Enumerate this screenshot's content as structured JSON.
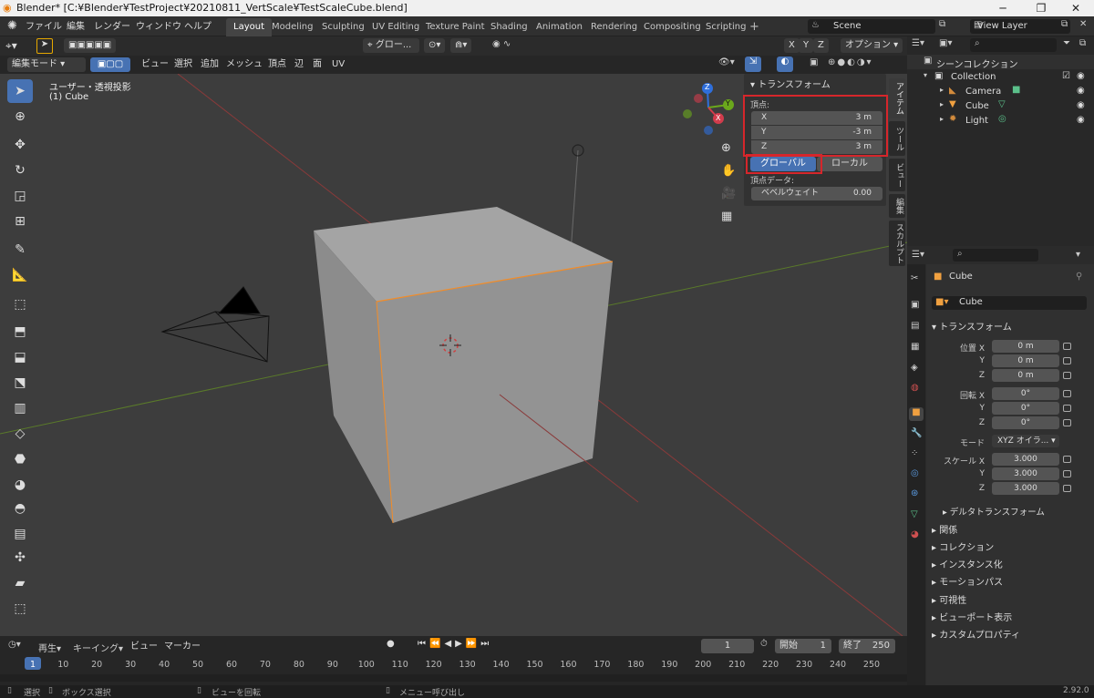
{
  "window": {
    "title": "Blender* [C:¥Blender¥TestProject¥20210811_VertScale¥TestScaleCube.blend]"
  },
  "menu": [
    "ファイル",
    "編集",
    "レンダー",
    "ウィンドウ",
    "ヘルプ"
  ],
  "workspaces": [
    "Layout",
    "Modeling",
    "Sculpting",
    "UV Editing",
    "Texture Paint",
    "Shading",
    "Animation",
    "Rendering",
    "Compositing",
    "Scripting"
  ],
  "active_workspace": "Layout",
  "scene": "Scene",
  "view_layer": "View Layer",
  "header": {
    "transform_orientation": "グロー...",
    "axes": [
      "X",
      "Y",
      "Z"
    ],
    "options": "オプション"
  },
  "header2": {
    "mode": "編集モード",
    "items": [
      "ビュー",
      "選択",
      "追加",
      "メッシュ",
      "頂点",
      "辺",
      "面",
      "UV"
    ]
  },
  "viewport": {
    "view_name": "ユーザー・透視投影",
    "object_name": "(1) Cube",
    "gizmo": {
      "x": "X",
      "y": "Y",
      "z": "Z"
    }
  },
  "npanel": {
    "header": "トランスフォーム",
    "vertex_label": "頂点:",
    "fields": [
      {
        "axis": "X",
        "value": "3 m"
      },
      {
        "axis": "Y",
        "value": "-3 m"
      },
      {
        "axis": "Z",
        "value": "3 m"
      }
    ],
    "global_label": "グローバル",
    "local_label": "ローカル",
    "vertex_data_label": "頂点データ:",
    "bevel_label": "ベベルウェイト",
    "bevel_value": "0.00",
    "tabs": [
      "アイテム",
      "ツール",
      "ビュー",
      "編集",
      "スカルプト"
    ]
  },
  "outliner": {
    "title": "シーンコレクション",
    "items": [
      {
        "name": "Collection"
      },
      {
        "name": "Camera"
      },
      {
        "name": "Cube"
      },
      {
        "name": "Light"
      }
    ]
  },
  "properties": {
    "object_name": "Cube",
    "data_name": "Cube",
    "section": "トランスフォーム",
    "location_label": "位置 X",
    "location": [
      "0 m",
      "0 m",
      "0 m"
    ],
    "rotation_label": "回転 X",
    "rotation": [
      "0°",
      "0°",
      "0°"
    ],
    "mode_label": "モード",
    "mode_value": "XYZ オイラ...",
    "scale_label": "スケール X",
    "scale": [
      "3.000",
      "3.000",
      "3.000"
    ],
    "axis_y": "Y",
    "axis_z": "Z",
    "delta": "デルタトランスフォーム",
    "sections": [
      "関係",
      "コレクション",
      "インスタンス化",
      "モーションパス",
      "可視性",
      "ビューポート表示",
      "カスタムプロパティ"
    ]
  },
  "timeline": {
    "menus": [
      "再生",
      "キーイング",
      "ビュー",
      "マーカー"
    ],
    "current_frame": "1",
    "start_label": "開始",
    "start": "1",
    "end_label": "終了",
    "end": "250",
    "ticks": [
      "1",
      "10",
      "20",
      "30",
      "40",
      "50",
      "60",
      "70",
      "80",
      "90",
      "100",
      "110",
      "120",
      "130",
      "140",
      "150",
      "160",
      "170",
      "180",
      "190",
      "200",
      "210",
      "220",
      "230",
      "240",
      "250"
    ]
  },
  "statusbar": {
    "select": "選択",
    "box_select": "ボックス選択",
    "rotate": "ビューを回転",
    "menu": "メニュー呼び出し",
    "version": "2.92.0"
  }
}
